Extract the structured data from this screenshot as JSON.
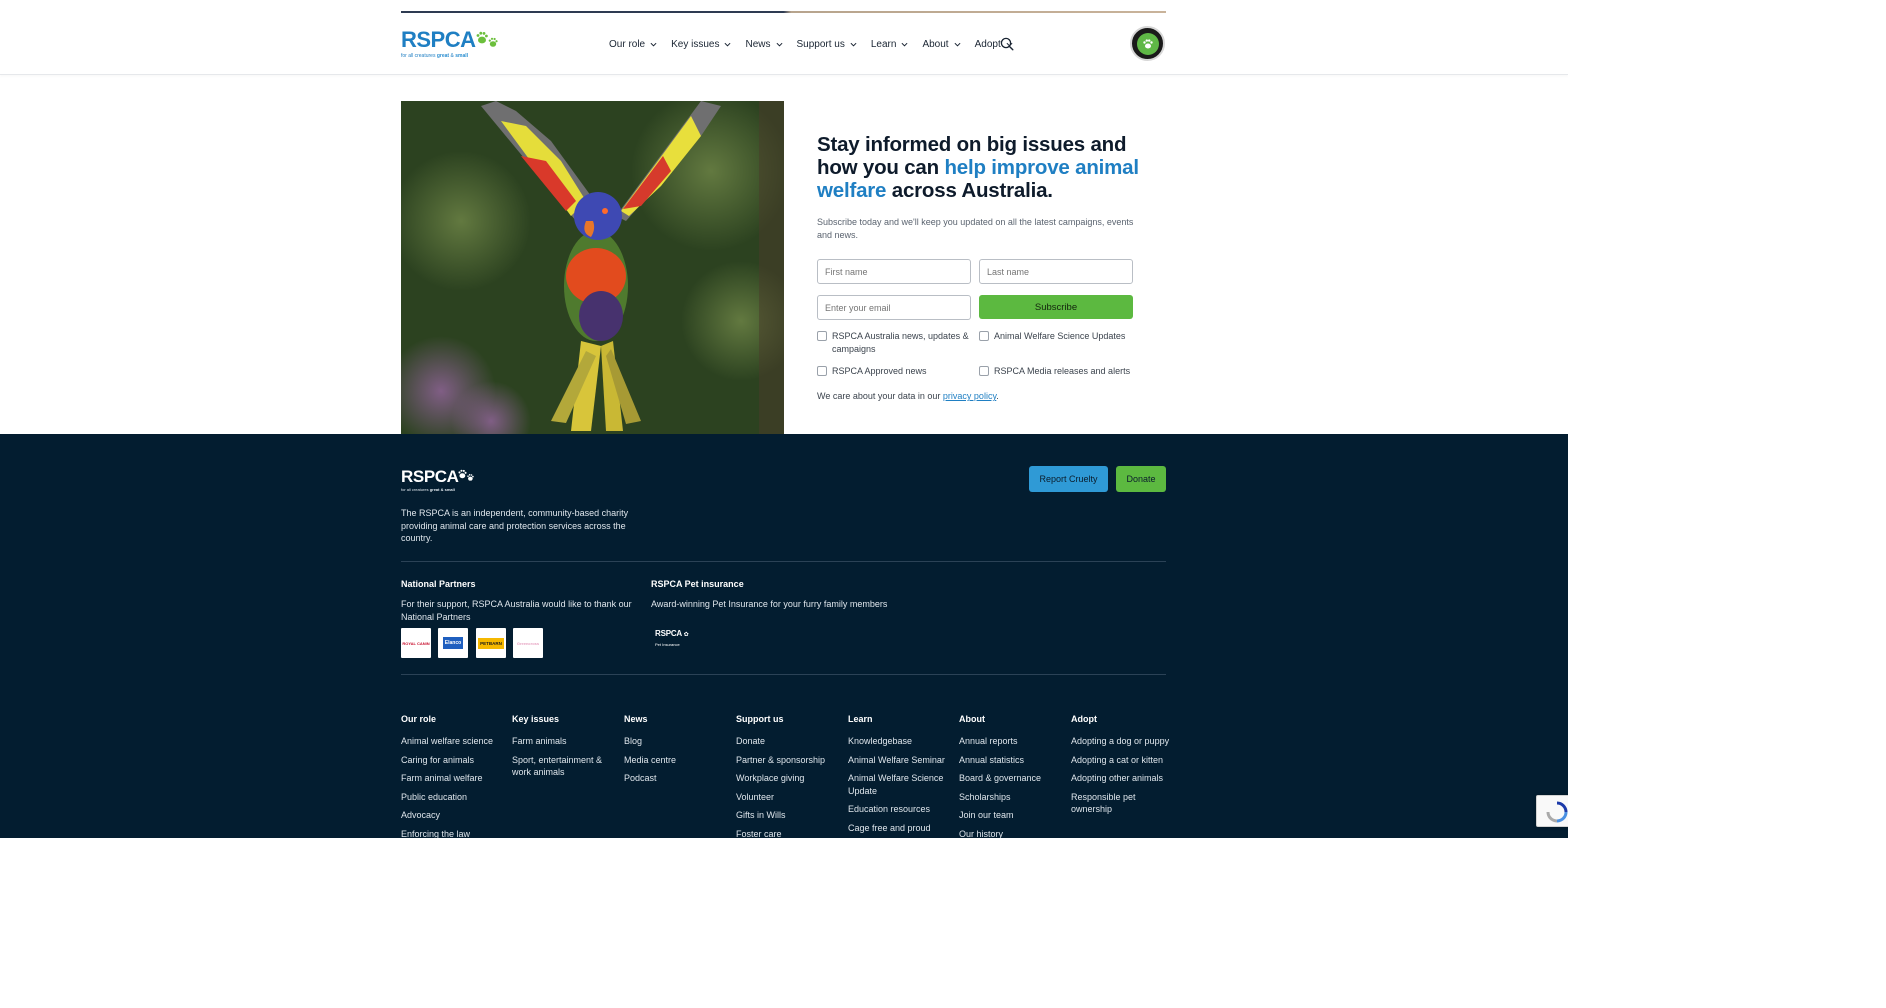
{
  "header": {
    "logo": {
      "word": "RSPCA",
      "tagline_prefix": "for all creatures",
      "tagline_great": "great",
      "tagline_amp": "&",
      "tagline_small": "small"
    },
    "nav": [
      {
        "label": "Our role"
      },
      {
        "label": "Key issues"
      },
      {
        "label": "News"
      },
      {
        "label": "Support us"
      },
      {
        "label": "Learn"
      },
      {
        "label": "About"
      },
      {
        "label": "Adopt"
      }
    ]
  },
  "hero": {
    "headline_part1": "Stay informed on big issues and how you can ",
    "headline_highlight": "help improve animal welfare",
    "headline_part2": " across Australia.",
    "subcopy": "Subscribe today and we'll keep you updated on all the latest campaigns, events and news.",
    "form": {
      "first_name_placeholder": "First name",
      "last_name_placeholder": "Last name",
      "email_placeholder": "Enter your email",
      "subscribe_label": "Subscribe"
    },
    "checkboxes": [
      {
        "label": "RSPCA Australia news, updates & campaigns"
      },
      {
        "label": "Animal Welfare Science Updates"
      },
      {
        "label": "RSPCA Approved news"
      },
      {
        "label": "RSPCA Media releases and alerts"
      }
    ],
    "privacy_prefix": "We care about your data in our ",
    "privacy_link": "privacy policy",
    "privacy_suffix": "."
  },
  "footer": {
    "logo": {
      "word": "RSPCA",
      "tagline_prefix": "for all creatures",
      "tagline_rest": "great & small"
    },
    "about": "The RSPCA is an independent, community-based charity providing animal care and protection services across the country.",
    "report_label": "Report Cruelty",
    "donate_label": "Donate",
    "partners_heading": "National Partners",
    "partners_text": "For their support, RSPCA Australia would like to thank our National Partners",
    "partners": [
      "ROYAL CANIN",
      "Elanco",
      "PETBARN",
      "Greencross"
    ],
    "pet_heading": "RSPCA Pet insurance",
    "pet_text": "Award-winning Pet Insurance for your furry family members",
    "pet_logo_word": "RSPCA",
    "pet_logo_sub": "Pet Insurance",
    "columns": [
      {
        "heading": "Our role",
        "links": [
          "Animal welfare science",
          "Caring for animals",
          "Farm animal welfare",
          "Public education",
          "Advocacy",
          "Enforcing the law"
        ]
      },
      {
        "heading": "Key issues",
        "links": [
          "Farm animals",
          "Sport, entertainment & work animals"
        ]
      },
      {
        "heading": "News",
        "links": [
          "Blog",
          "Media centre",
          "Podcast"
        ]
      },
      {
        "heading": "Support us",
        "links": [
          "Donate",
          "Partner & sponsorship",
          "Workplace giving",
          "Volunteer",
          "Gifts in Wills",
          "Foster care"
        ]
      },
      {
        "heading": "Learn",
        "links": [
          "Knowledgebase",
          "Animal Welfare Seminar",
          "Animal Welfare Science Update",
          "Education resources",
          "Cage free and proud"
        ]
      },
      {
        "heading": "About",
        "links": [
          "Annual reports",
          "Annual statistics",
          "Board & governance",
          "Scholarships",
          "Join our team",
          "Our history"
        ]
      },
      {
        "heading": "Adopt",
        "links": [
          "Adopting a dog or puppy",
          "Adopting a cat or kitten",
          "Adopting other animals",
          "Responsible pet ownership"
        ]
      }
    ]
  },
  "colors": {
    "brand_blue": "#1f7fc3",
    "brand_green": "#5cb940",
    "footer_bg": "#031d30",
    "report_blue": "#2f9ad6"
  }
}
